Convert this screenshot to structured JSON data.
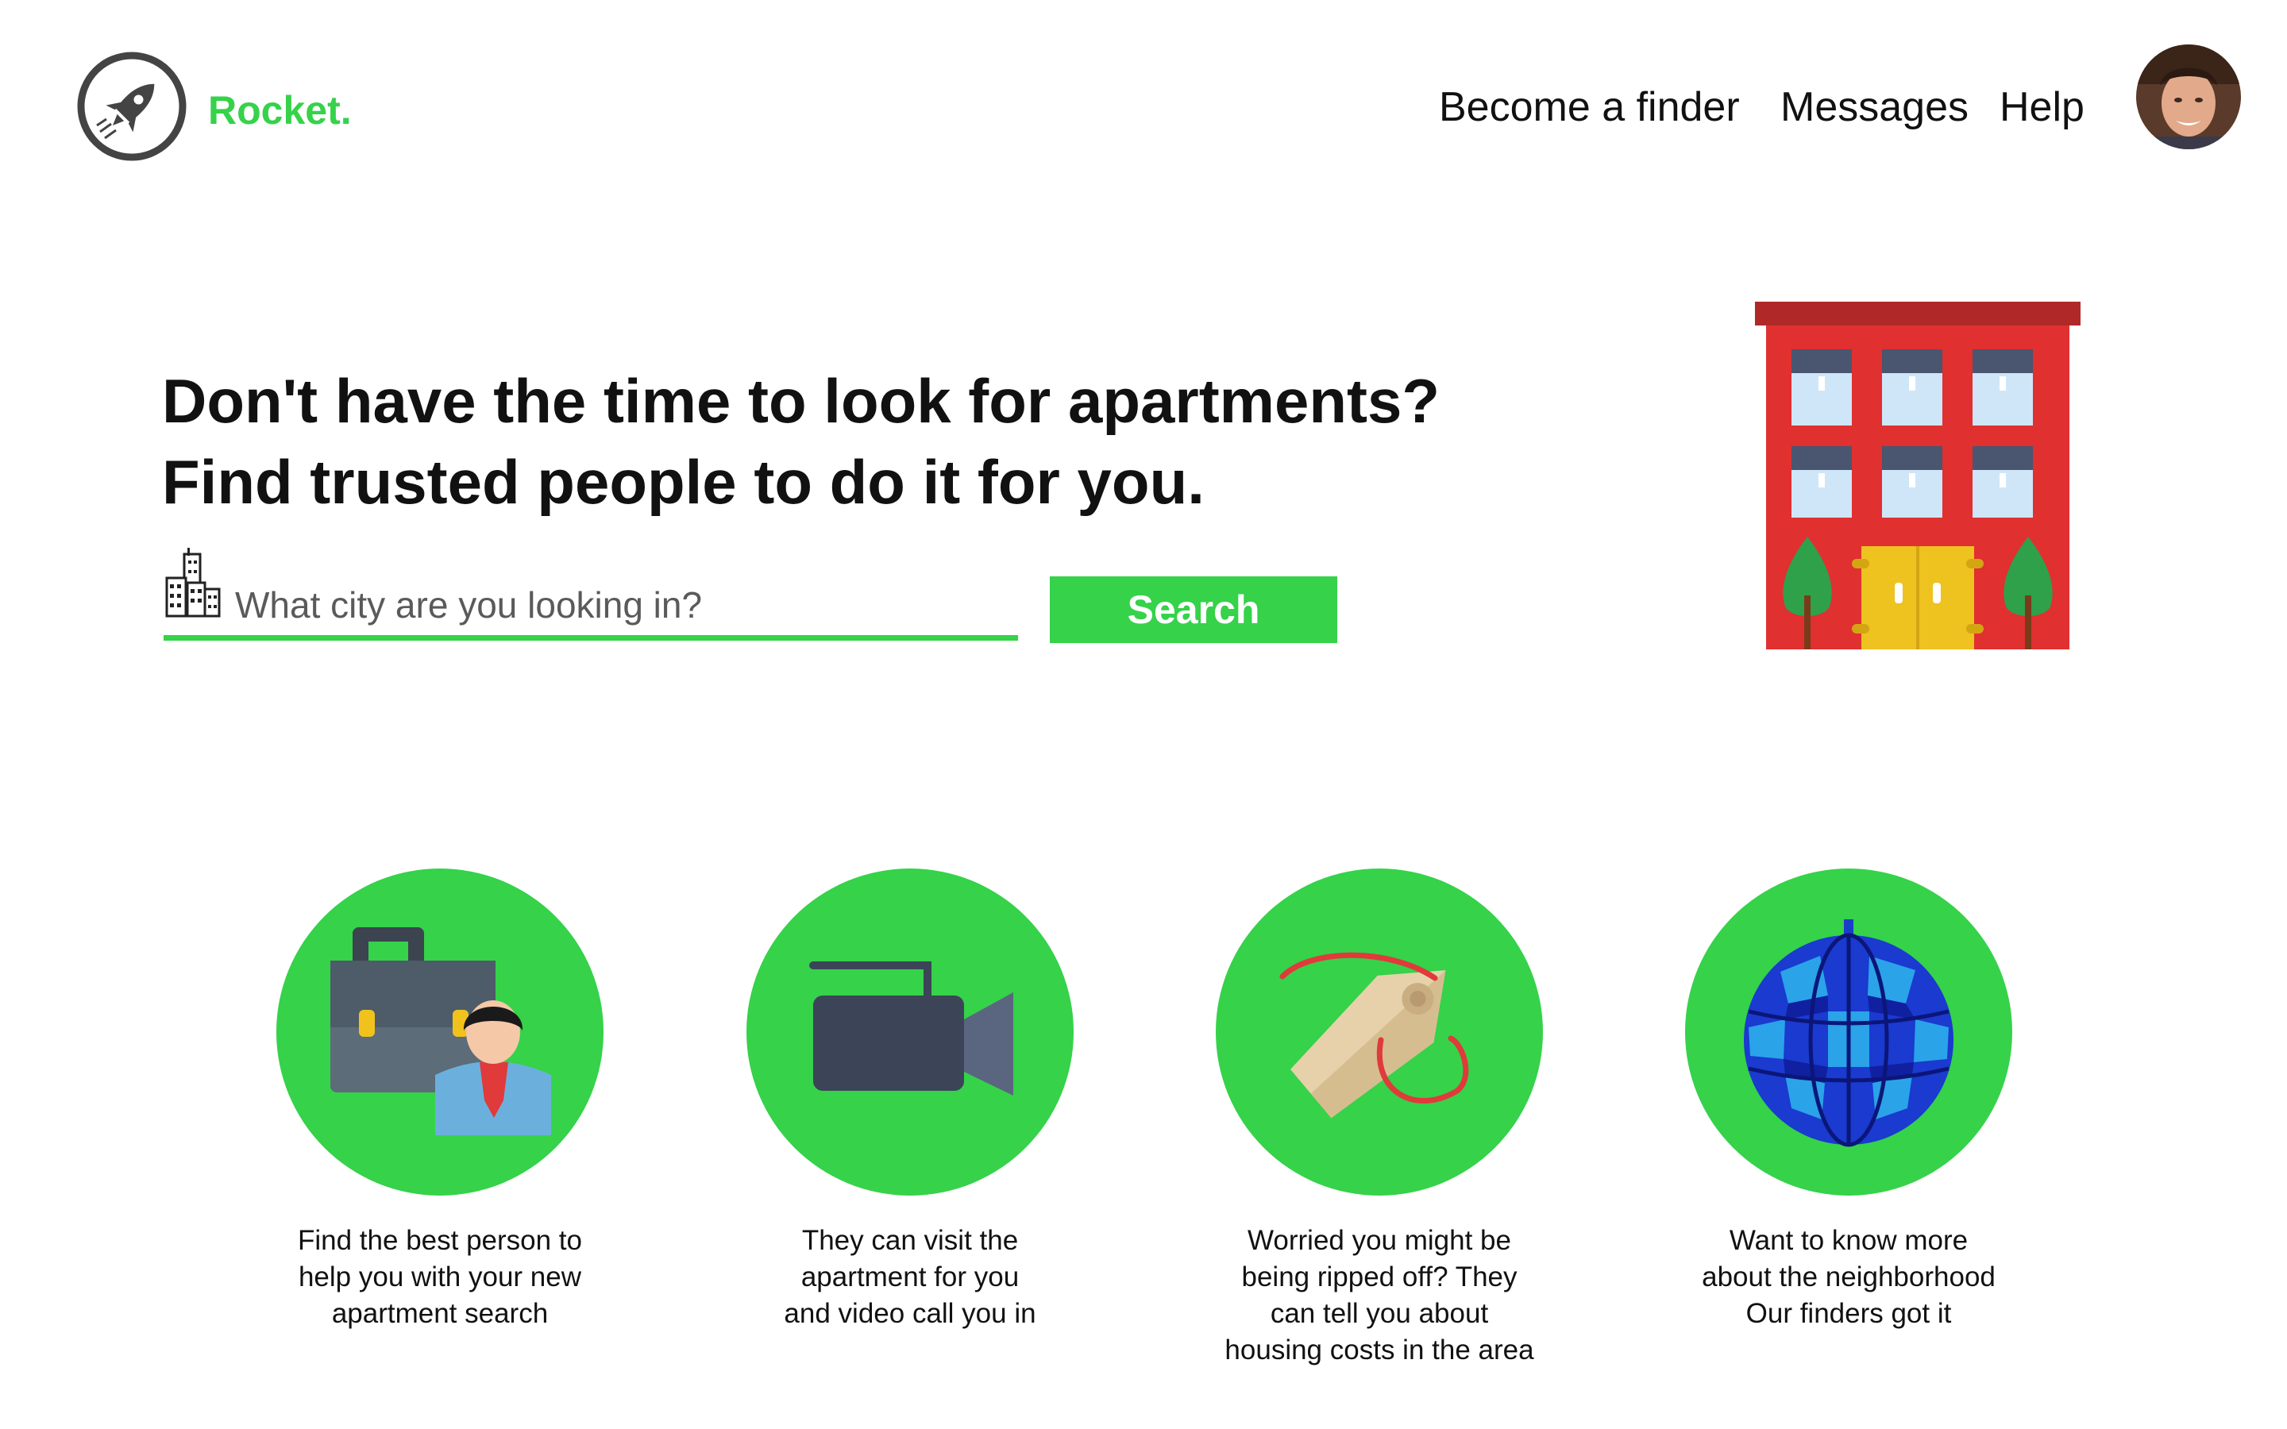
{
  "header": {
    "brand": "Rocket.",
    "logo_icon": "rocket-icon",
    "nav": {
      "become_finder": "Become a finder",
      "messages": "Messages",
      "help": "Help"
    },
    "avatar_icon": "user-avatar"
  },
  "hero": {
    "headline_line1": "Don't have the time to look for apartments?",
    "headline_line2": "Find trusted people to do it for you.",
    "search": {
      "icon": "city-buildings-icon",
      "placeholder": "What city are you looking in?",
      "value": "",
      "button_label": "Search"
    },
    "illustration": "apartment-building-illustration"
  },
  "features": [
    {
      "icon": "briefcase-person-icon",
      "text": "Find the best person to\nhelp you with your new\napartment search"
    },
    {
      "icon": "video-camera-icon",
      "text": "They can visit the\napartment for you\nand video call you in"
    },
    {
      "icon": "price-tag-icon",
      "text": "Worried you might be\nbeing ripped off?  They\ncan tell you about\nhousing costs in the area"
    },
    {
      "icon": "globe-icon",
      "text": "Want to know more\nabout the neighborhood\nOur finders got it"
    }
  ],
  "colors": {
    "accent": "#35d24a",
    "text": "#111111",
    "building_red": "#e03030"
  }
}
